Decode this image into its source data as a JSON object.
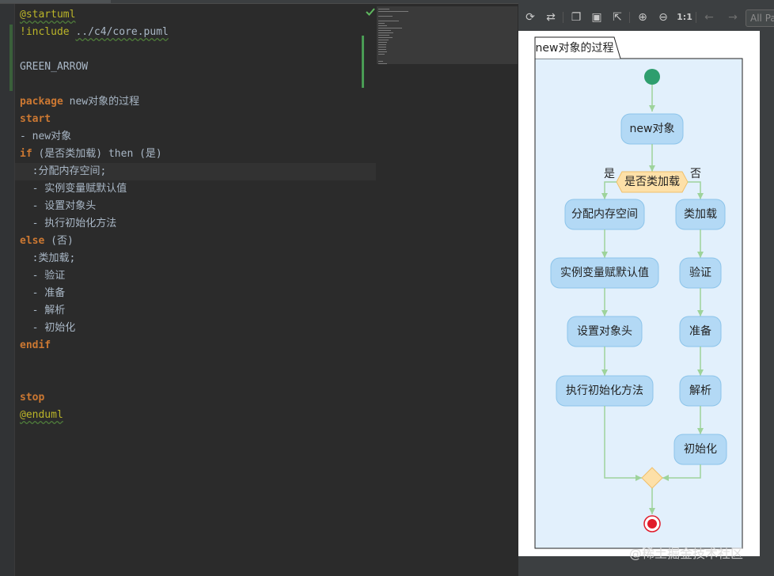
{
  "editor": {
    "lines": [
      [
        {
          "c": "t-anno",
          "t": "@startuml"
        }
      ],
      [
        {
          "c": "t-include",
          "t": "!include "
        },
        {
          "c": "t-inc-path",
          "t": "../c4/core.puml"
        }
      ],
      [],
      [
        {
          "c": "t-text",
          "t": "GREEN_ARROW"
        }
      ],
      [],
      [
        {
          "c": "t-kw",
          "t": "package"
        },
        {
          "c": "t-text",
          "t": " new对象的过程"
        }
      ],
      [
        {
          "c": "t-kw",
          "t": "start"
        }
      ],
      [
        {
          "c": "t-text",
          "t": "- new对象"
        }
      ],
      [
        {
          "c": "t-kw",
          "t": "if"
        },
        {
          "c": "t-cond",
          "t": " (是否类加载) then (是)"
        }
      ],
      [
        {
          "c": "t-text",
          "t": "  :分配内存空间;"
        }
      ],
      [
        {
          "c": "t-text",
          "t": "  - 实例变量赋默认值"
        }
      ],
      [
        {
          "c": "t-text",
          "t": "  - 设置对象头"
        }
      ],
      [
        {
          "c": "t-text",
          "t": "  - 执行初始化方法"
        }
      ],
      [
        {
          "c": "t-kw",
          "t": "else"
        },
        {
          "c": "t-cond",
          "t": " (否)"
        }
      ],
      [
        {
          "c": "t-text",
          "t": "  :类加载;"
        }
      ],
      [
        {
          "c": "t-text",
          "t": "  - 验证"
        }
      ],
      [
        {
          "c": "t-text",
          "t": "  - 准备"
        }
      ],
      [
        {
          "c": "t-text",
          "t": "  - 解析"
        }
      ],
      [
        {
          "c": "t-text",
          "t": "  - 初始化"
        }
      ],
      [
        {
          "c": "t-kw",
          "t": "endif"
        }
      ],
      [],
      [],
      [
        {
          "c": "t-kw",
          "t": "stop"
        }
      ],
      [
        {
          "c": "t-anno",
          "t": "@enduml"
        }
      ]
    ],
    "current_line": 9
  },
  "toolbar": {
    "buttons": [
      {
        "name": "refresh-icon",
        "glyph": "⟳",
        "enabled": true
      },
      {
        "name": "sync-icon",
        "glyph": "⇄",
        "enabled": true
      },
      {
        "name": "copy-icon",
        "glyph": "❐",
        "enabled": true
      },
      {
        "name": "save-icon",
        "glyph": "▣",
        "enabled": true
      },
      {
        "name": "open-external-icon",
        "glyph": "⇱",
        "enabled": true
      },
      {
        "name": "zoom-in-icon",
        "glyph": "⊕",
        "enabled": true
      },
      {
        "name": "zoom-out-icon",
        "glyph": "⊖",
        "enabled": true
      },
      {
        "name": "actual-size-icon",
        "glyph": "1:1",
        "enabled": true
      },
      {
        "name": "prev-page-icon",
        "glyph": "←",
        "enabled": false
      },
      {
        "name": "next-page-icon",
        "glyph": "→",
        "enabled": false
      }
    ],
    "page_select": "All Pa"
  },
  "diagram": {
    "package_title": "new对象的过程",
    "start_node": "new对象",
    "condition": "是否类加载",
    "yes_label": "是",
    "no_label": "否",
    "yes_branch": [
      "分配内存空间",
      "实例变量赋默认值",
      "设置对象头",
      "执行初始化方法"
    ],
    "no_branch": [
      "类加载",
      "验证",
      "准备",
      "解析",
      "初始化"
    ],
    "colors": {
      "package_fill": "#e2f0fc",
      "activity_fill": "#b3d9f5",
      "activity_stroke": "#8cc4ea",
      "arrow": "#9ed39b",
      "diamond_fill": "#fde0a8",
      "diamond_stroke": "#f0c06a",
      "start_fill": "#2e9e6e",
      "end_fill": "#e01b2a"
    }
  },
  "watermark": "@稀土掘金技术社区"
}
